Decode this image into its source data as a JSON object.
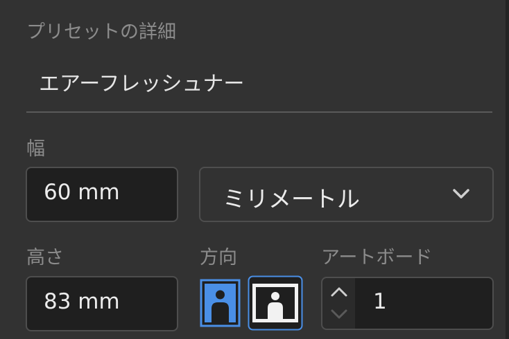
{
  "section": {
    "title": "プリセットの詳細"
  },
  "preset": {
    "name": "エアーフレッシュナー"
  },
  "width": {
    "label": "幅",
    "value": "60 mm"
  },
  "units": {
    "selected": "ミリメートル",
    "icon": "chevron-down-icon"
  },
  "height": {
    "label": "高さ",
    "value": "83 mm"
  },
  "orientation": {
    "label": "方向",
    "options": [
      "portrait",
      "landscape"
    ],
    "selected": "portrait"
  },
  "artboards": {
    "label": "アートボード",
    "value": "1"
  },
  "colors": {
    "panel_bg": "#323232",
    "field_bg": "#1f1f1f",
    "accent": "#4a8fe6",
    "label_text": "#8c8c8c",
    "value_text": "#ececec"
  }
}
